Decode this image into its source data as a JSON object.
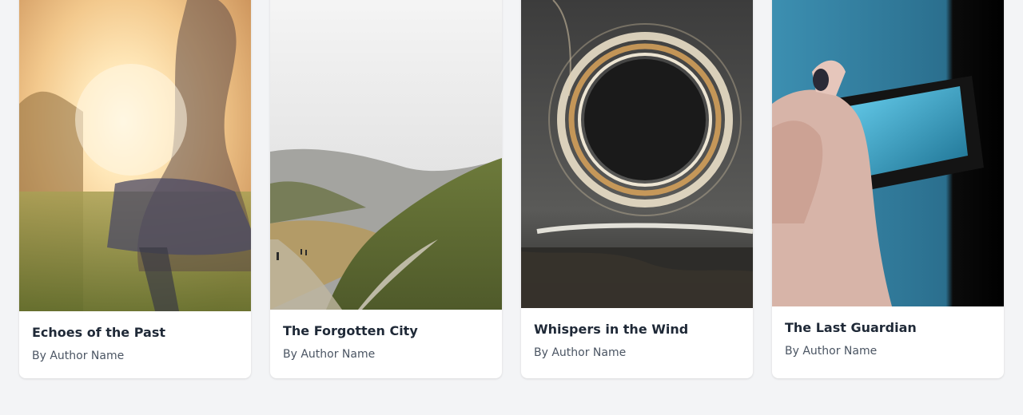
{
  "books": [
    {
      "title": "Echoes of the Past",
      "author": "By Author Name",
      "cover_icon": "woman-in-sunlit-field-image"
    },
    {
      "title": "The Forgotten City",
      "author": "By Author Name",
      "cover_icon": "mountain-trail-image"
    },
    {
      "title": "Whispers in the Wind",
      "author": "By Author Name",
      "cover_icon": "light-ring-image"
    },
    {
      "title": "The Last Guardian",
      "author": "By Author Name",
      "cover_icon": "phone-photo-image"
    }
  ],
  "colors": {
    "page_background": "#f3f4f6",
    "card_background": "#ffffff",
    "title_color": "#1f2937",
    "author_color": "#4b5563"
  }
}
